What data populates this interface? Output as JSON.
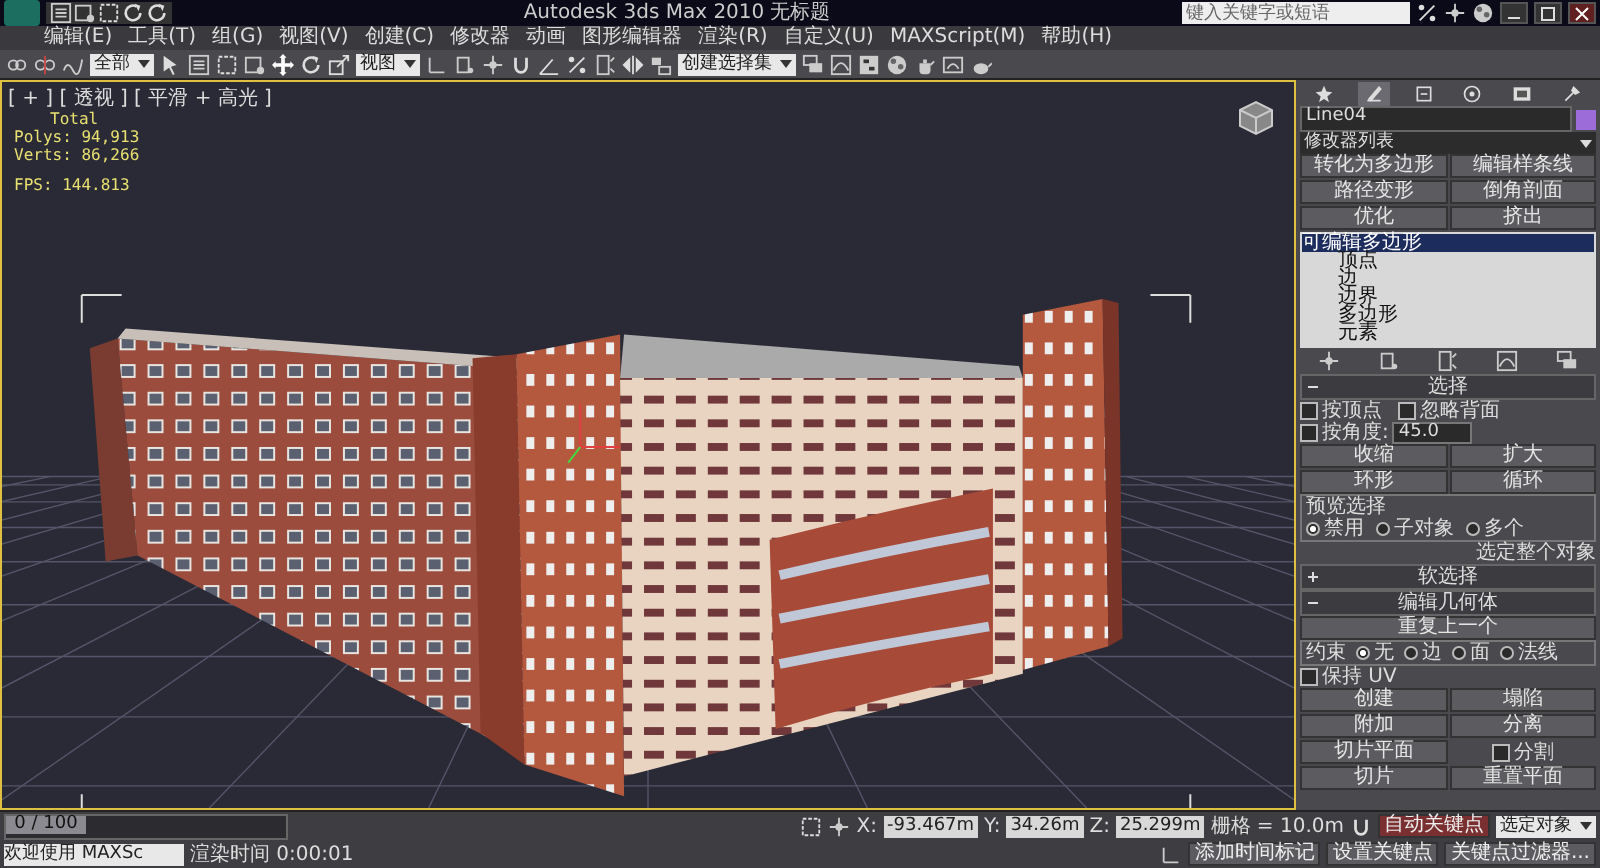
{
  "window": {
    "title": "Autodesk 3ds Max 2010",
    "document": "无标题",
    "search": {
      "placeholder": "键入关键字或短语"
    }
  },
  "menu": [
    "编辑(E)",
    "工具(T)",
    "组(G)",
    "视图(V)",
    "创建(C)",
    "修改器",
    "动画",
    "图形编辑器",
    "渲染(R)",
    "自定义(U)",
    "MAXScript(M)",
    "帮助(H)"
  ],
  "toolbar": {
    "selection_filter": "全部",
    "reference_coordinate": "视图",
    "named_selection": "创建选择集"
  },
  "viewport": {
    "label": "[ + ] [ 透视 ] [ 平滑 + 高光 ]",
    "stats_title": "Total",
    "stats": [
      {
        "label": "Polys:",
        "value": "94,913"
      },
      {
        "label": "Verts:",
        "value": "86,266"
      }
    ],
    "fps": {
      "label": "FPS:",
      "value": "144.813"
    }
  },
  "command_panel": {
    "tabs": [
      {
        "selected": false
      },
      {
        "selected": true
      },
      {
        "selected": false
      },
      {
        "selected": false
      },
      {
        "selected": false
      },
      {
        "selected": false
      }
    ],
    "object_name": "Line04",
    "modifier_list": "修改器列表",
    "modifier_buttons": [
      "转化为多边形",
      "编辑样条线",
      "路径变形",
      "倒角剖面",
      "优化",
      "挤出"
    ],
    "stack": [
      {
        "label": "可编辑多边形",
        "selected": true,
        "children": [
          {
            "label": "顶点",
            "selected": false
          },
          {
            "label": "边",
            "selected": false
          },
          {
            "label": "边界",
            "selected": false
          },
          {
            "label": "多边形",
            "selected": false
          },
          {
            "label": "元素",
            "selected": false
          }
        ]
      }
    ],
    "selection": {
      "title": "选择",
      "expanded": true,
      "checks": [
        {
          "label": "按顶点",
          "checked": false
        },
        {
          "label": "忽略背面",
          "checked": false
        },
        {
          "label": "按角度:",
          "checked": false,
          "value": "45.0"
        }
      ],
      "buttons": [
        [
          "收缩",
          "扩大"
        ],
        [
          "环形",
          "循环"
        ]
      ],
      "preview": {
        "title": "预览选择",
        "options": [
          {
            "label": "禁用",
            "selected": true
          },
          {
            "label": "子对象",
            "selected": false
          },
          {
            "label": "多个",
            "selected": false
          }
        ]
      },
      "note": "选定整个对象"
    },
    "soft_selection": {
      "title": "软选择",
      "expanded": false
    },
    "edit_geometry": {
      "title": "编辑几何体",
      "expanded": true,
      "repeat": "重复上一个",
      "constraints": {
        "title": "约束",
        "options": [
          {
            "label": "无",
            "selected": true
          },
          {
            "label": "边",
            "selected": false
          },
          {
            "label": "面",
            "selected": false
          },
          {
            "label": "法线",
            "selected": false
          }
        ]
      },
      "preserve_uv": {
        "label": "保持 UV",
        "checked": false
      },
      "controls": [
        {
          "kind": "button",
          "label": "创建"
        },
        {
          "kind": "button",
          "label": "塌陷"
        },
        {
          "kind": "button",
          "label": "附加"
        },
        {
          "kind": "button",
          "label": "分离"
        },
        {
          "kind": "button",
          "label": "切片平面"
        },
        {
          "kind": "checkbox",
          "label": "分割",
          "checked": false
        },
        {
          "kind": "button",
          "label": "切片"
        },
        {
          "kind": "button",
          "label": "重置平面"
        }
      ]
    }
  },
  "status_bar": {
    "timeline": {
      "label": "0 / 100",
      "level": 0
    },
    "listener": "欢迎使用 MAXSc",
    "render_time": "渲染时间 0:00:01",
    "coords": [
      {
        "axis": "X:",
        "value": "-93.467m"
      },
      {
        "axis": "Y:",
        "value": "34.26m"
      },
      {
        "axis": "Z:",
        "value": "25.299m"
      }
    ],
    "grid": "栅格 = 10.0m",
    "add_time_tag": "添加时间标记",
    "auto_key": "自动关键点",
    "key_mode": "选定对象",
    "set_key": "设置关键点",
    "key_filters": "关键点过滤器..."
  }
}
